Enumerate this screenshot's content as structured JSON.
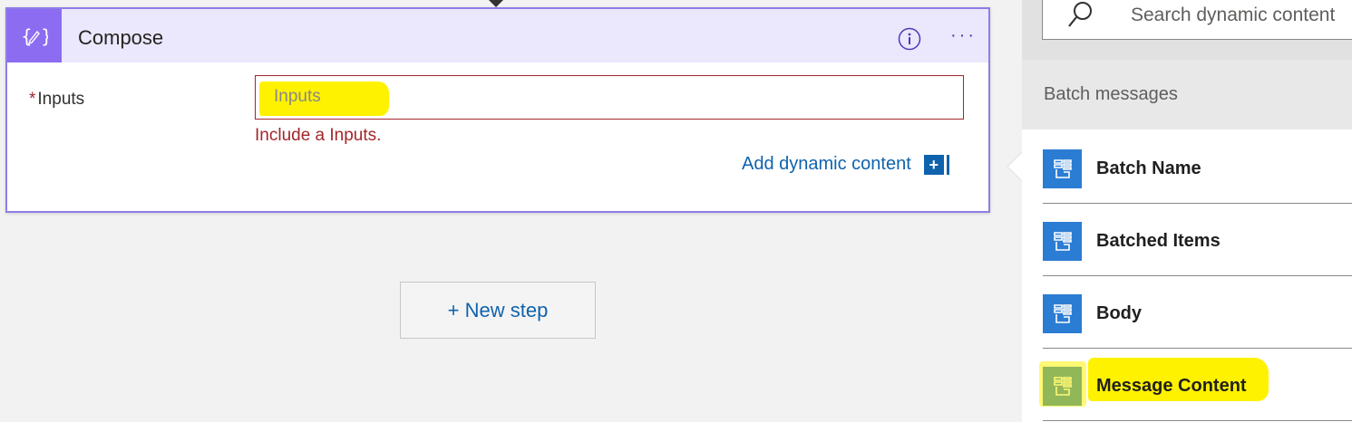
{
  "compose": {
    "title": "Compose",
    "icon": "code-braces-pencil-icon",
    "field": {
      "required_mark": "*",
      "label": "Inputs",
      "placeholder": "Inputs",
      "error": "Include a Inputs."
    },
    "add_dynamic_label": "Add dynamic content",
    "add_dynamic_icon": "+"
  },
  "new_step_label": "+ New step",
  "panel": {
    "search_placeholder": "Search dynamic content",
    "section_title": "Batch messages",
    "items": [
      {
        "label": "Batch Name",
        "icon": "property-icon"
      },
      {
        "label": "Batched Items",
        "icon": "property-icon"
      },
      {
        "label": "Body",
        "icon": "property-icon"
      },
      {
        "label": "Message Content",
        "icon": "property-icon"
      }
    ]
  },
  "colors": {
    "accent_purple": "#8c6cf0",
    "link_blue": "#0f63ad",
    "error_red": "#a4262c",
    "highlight_yellow": "#fff200"
  }
}
